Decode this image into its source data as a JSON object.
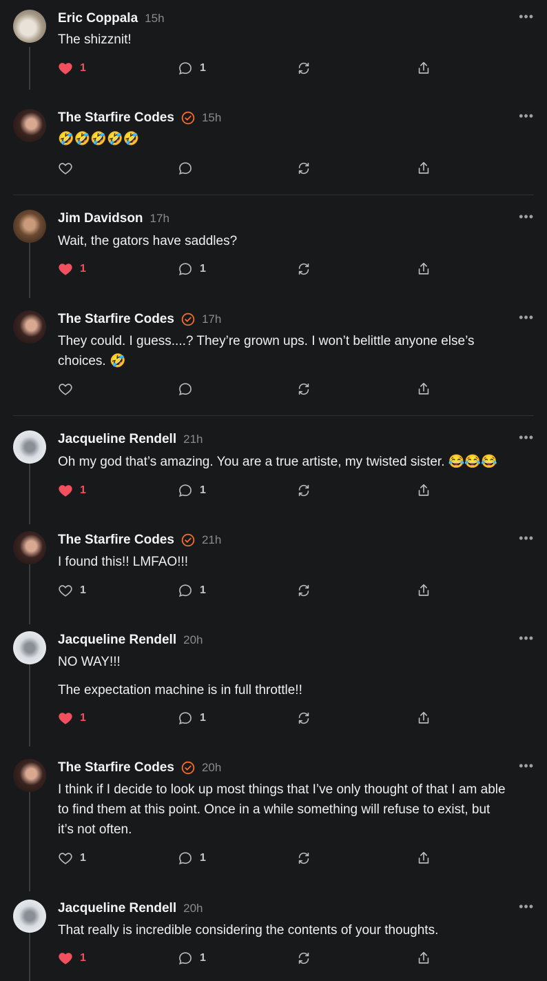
{
  "posts": [
    {
      "author": "Eric Coppala",
      "verified": false,
      "time": "15h",
      "lines": [
        "The shizznit!"
      ],
      "liked": true,
      "likes": "1",
      "replies": "1",
      "avatar": "a1"
    },
    {
      "author": "The Starfire Codes",
      "verified": true,
      "time": "15h",
      "lines": [
        "🤣🤣🤣🤣🤣"
      ],
      "liked": false,
      "likes": "",
      "replies": "",
      "avatar": "a2"
    },
    {
      "author": "Jim Davidson",
      "verified": false,
      "time": "17h",
      "lines": [
        "Wait, the gators have saddles?"
      ],
      "liked": true,
      "likes": "1",
      "replies": "1",
      "avatar": "a3"
    },
    {
      "author": "The Starfire Codes",
      "verified": true,
      "time": "17h",
      "lines": [
        "They could. I guess....? They’re grown ups. I won’t belittle anyone else’s",
        "choices. 🤣"
      ],
      "liked": false,
      "likes": "",
      "replies": "",
      "avatar": "a2"
    },
    {
      "author": "Jacqueline Rendell",
      "verified": false,
      "time": "21h",
      "lines": [
        "Oh my god that’s amazing. You are a true artiste, my twisted sister. 😂😂😂"
      ],
      "liked": true,
      "likes": "1",
      "replies": "1",
      "avatar": "a4"
    },
    {
      "author": "The Starfire Codes",
      "verified": true,
      "time": "21h",
      "lines": [
        "I found this!! LMFAO!!!"
      ],
      "liked": false,
      "likes": "1",
      "replies": "1",
      "avatar": "a2"
    },
    {
      "author": "Jacqueline Rendell",
      "verified": false,
      "time": "20h",
      "lines": [
        "NO WAY!!!",
        "",
        "The expectation machine is in full throttle!!"
      ],
      "liked": true,
      "likes": "1",
      "replies": "1",
      "avatar": "a4"
    },
    {
      "author": "The Starfire Codes",
      "verified": true,
      "time": "20h",
      "lines": [
        "I think if I decide to look up most things that I’ve only thought of that I am able",
        "to find them at this point. Once in a while something will refuse to exist, but",
        "it’s not often."
      ],
      "liked": false,
      "likes": "1",
      "replies": "1",
      "avatar": "a2"
    },
    {
      "author": "Jacqueline Rendell",
      "verified": false,
      "time": "20h",
      "lines": [
        "That really is incredible considering the contents of your thoughts."
      ],
      "liked": true,
      "likes": "1",
      "replies": "1",
      "avatar": "a4"
    }
  ],
  "more_label": "•••",
  "colors": {
    "like": "#f2505e",
    "verified": "#f26b2a",
    "icon": "#b9babe"
  },
  "icons": {
    "like": "heart-icon",
    "reply": "comment-icon",
    "repost": "repost-icon",
    "share": "share-icon",
    "more": "more-icon"
  }
}
